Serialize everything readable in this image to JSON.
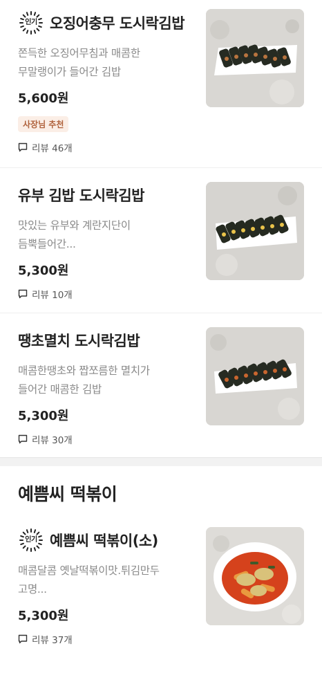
{
  "items": [
    {
      "badge": "인기",
      "title": "오징어충무 도시락김밥",
      "desc_line1": "쫀득한 오징어무침과 매콤한",
      "desc_line2": "무말랭이가 들어간 김밥",
      "price": "5,600원",
      "recommend": "사장님 추천",
      "review": "리뷰 46개",
      "image_icon": "gimbap-plate-image"
    },
    {
      "title": "유부 김밥 도시락김밥",
      "desc_line1": "맛있는 유부와 계란지단이",
      "desc_line2": "듬뿍들어간...",
      "price": "5,300원",
      "review": "리뷰 10개",
      "image_icon": "gimbap-plate-image"
    },
    {
      "title": "땡초멸치 도시락김밥",
      "desc_line1": "매콤한땡초와 짭쪼름한 멸치가",
      "desc_line2": "들어간 매콤한 김밥",
      "price": "5,300원",
      "review": "리뷰 30개",
      "image_icon": "gimbap-plate-image"
    }
  ],
  "section": {
    "title": "예쁨씨 떡볶이"
  },
  "section_items": [
    {
      "badge": "인기",
      "title": "예쁨씨 떡볶이(소)",
      "desc_line1": "매콤달콤 옛날떡볶이맛.튀김만두",
      "desc_line2": "고명...",
      "price": "5,300원",
      "review": "리뷰 37개",
      "image_icon": "tteokbokki-bowl-image"
    }
  ],
  "colors": {
    "recommend_bg": "#fbeee6",
    "recommend_text": "#b0623c",
    "desc_text": "#8a8a8a"
  }
}
